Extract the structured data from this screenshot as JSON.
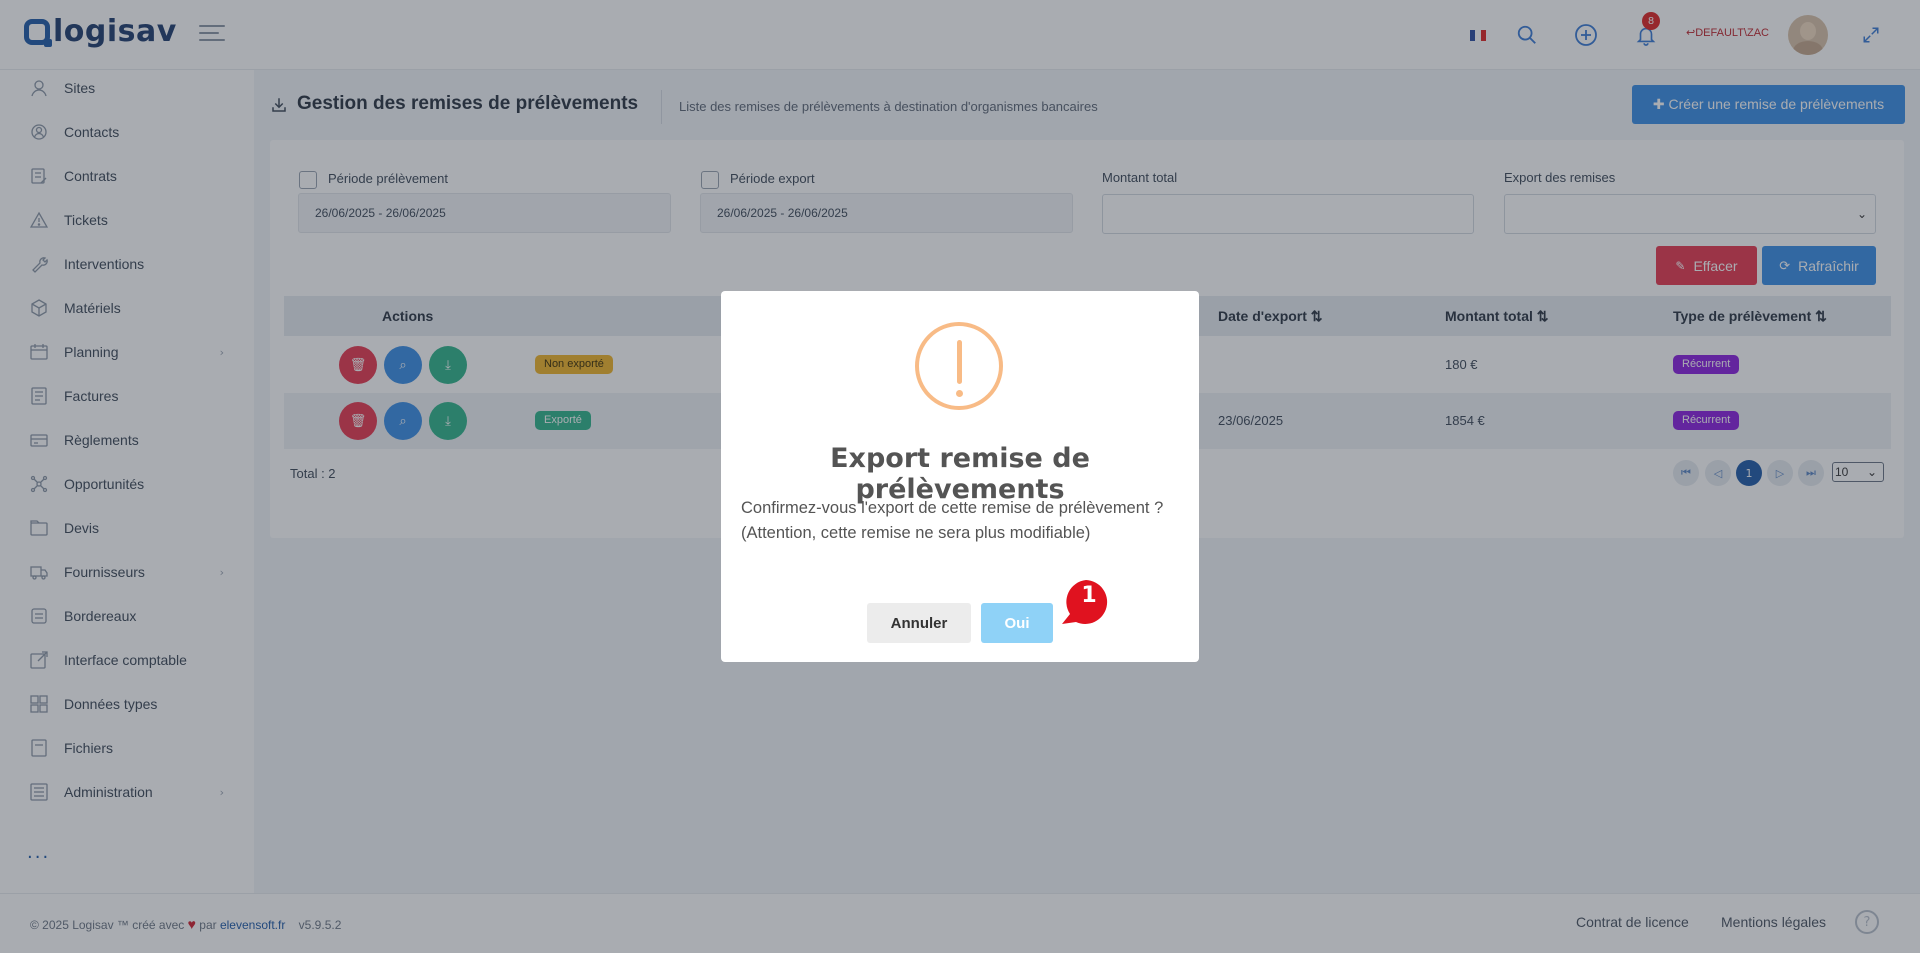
{
  "app": {
    "logo_text": "logisav",
    "user_name": "DEFAULT\\ZAC",
    "notification_count": "8"
  },
  "sidebar": {
    "items": [
      {
        "label": "Sites",
        "icon": "location-icon",
        "has_children": false
      },
      {
        "label": "Contacts",
        "icon": "contact-icon",
        "has_children": false
      },
      {
        "label": "Contrats",
        "icon": "contract-icon",
        "has_children": false
      },
      {
        "label": "Tickets",
        "icon": "warning-icon",
        "has_children": false
      },
      {
        "label": "Interventions",
        "icon": "wrench-icon",
        "has_children": false
      },
      {
        "label": "Matériels",
        "icon": "box-icon",
        "has_children": false
      },
      {
        "label": "Planning",
        "icon": "calendar-icon",
        "has_children": true
      },
      {
        "label": "Factures",
        "icon": "invoice-icon",
        "has_children": false
      },
      {
        "label": "Règlements",
        "icon": "payment-icon",
        "has_children": false
      },
      {
        "label": "Opportunités",
        "icon": "network-icon",
        "has_children": false
      },
      {
        "label": "Devis",
        "icon": "folder-icon",
        "has_children": false
      },
      {
        "label": "Fournisseurs",
        "icon": "truck-icon",
        "has_children": true
      },
      {
        "label": "Bordereaux",
        "icon": "stack-icon",
        "has_children": false
      },
      {
        "label": "Interface comptable",
        "icon": "external-link-icon",
        "has_children": false
      },
      {
        "label": "Données types",
        "icon": "grid-icon",
        "has_children": false
      },
      {
        "label": "Fichiers",
        "icon": "file-icon",
        "has_children": false
      },
      {
        "label": "Administration",
        "icon": "settings-list-icon",
        "has_children": true
      }
    ],
    "more": "..."
  },
  "page": {
    "title": "Gestion des remises de prélèvements",
    "subtitle": "Liste des remises de prélèvements à destination d'organismes bancaires",
    "create_button": "✚ Créer une remise de prélèvements"
  },
  "filters": {
    "periode_prelevement_label": "Période prélèvement",
    "periode_prelevement_value": "26/06/2025 - 26/06/2025",
    "periode_export_label": "Période export",
    "periode_export_value": "26/06/2025 - 26/06/2025",
    "montant_total_label": "Montant total",
    "export_remises_label": "Export des remises",
    "clear_button": "Effacer",
    "refresh_button": "Rafraîchir"
  },
  "table": {
    "headers": {
      "actions": "Actions",
      "date_export": "Date d'export",
      "montant_total": "Montant total",
      "type": "Type de prélèvement"
    },
    "rows": [
      {
        "status": "Non exporté",
        "status_color": "#f0b429",
        "date_export": "",
        "montant": "180 €",
        "type": "Récurrent"
      },
      {
        "status": "Exporté",
        "status_color": "#2fb58a",
        "date_export": "23/06/2025",
        "montant": "1854 €",
        "type": "Récurrent"
      }
    ],
    "total": "Total : 2",
    "current_page": "1",
    "page_size": "10"
  },
  "footer": {
    "copyright": "© 2025 Logisav ™ créé avec",
    "par": "par",
    "company": "elevensoft.fr",
    "version": "v5.9.5.2",
    "licence": "Contrat de licence",
    "mentions": "Mentions légales",
    "help": "?"
  },
  "modal": {
    "title": "Export remise de prélèvements",
    "text": "Confirmez-vous l'export de cette remise de prélèvement ? (Attention, cette remise ne sera plus modifiable)",
    "cancel": "Annuler",
    "confirm": "Oui",
    "marker": "1"
  },
  "colors": {
    "primary": "#1e5aa8",
    "accent": "#3a8ee6",
    "danger": "#e8384f",
    "success": "#2fb58a",
    "purple": "#8b1fe0"
  }
}
